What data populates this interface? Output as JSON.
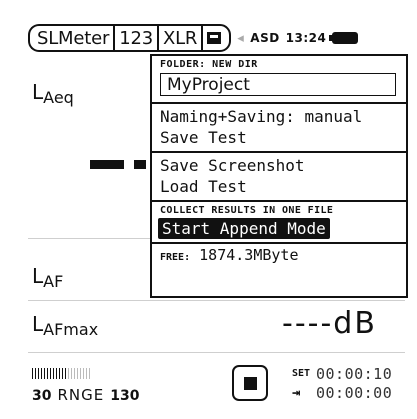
{
  "statusbar": {
    "tab_app": "SLMeter",
    "tab_mode": "123",
    "tab_input": "XLR",
    "memory_icon": "sd-card-icon",
    "speaker_icon": "speaker-icon",
    "asd_label": "ASD",
    "clock": "13:24",
    "battery_icon": "battery-icon"
  },
  "meter": {
    "laeq_main": "L",
    "laeq_sub": "Aeq",
    "laf_main": "L",
    "laf_sub": "AF",
    "lafmax_main": "L",
    "lafmax_sub": "AFmax",
    "lafmax_value": "----dB"
  },
  "bottombar": {
    "range_low": "30",
    "range_label": "RNGE",
    "range_high": "130",
    "stop_icon": "stop-icon",
    "set_label": "SET",
    "set_time": "00:00:10",
    "elapsed_icon": "arrow-to-bar-icon",
    "elapsed_time": "00:00:00"
  },
  "menu": {
    "folder_header": "FOLDER: NEW DIR",
    "folder_value": "MyProject",
    "naming_saving": "Naming+Saving: manual",
    "save_test": "Save Test",
    "save_screenshot": "Save Screenshot",
    "load_test": "Load Test",
    "collect_header": "COLLECT RESULTS IN ONE FILE",
    "start_append": "Start Append Mode",
    "free_label": "FREE:",
    "free_value": "1874.3MByte"
  }
}
